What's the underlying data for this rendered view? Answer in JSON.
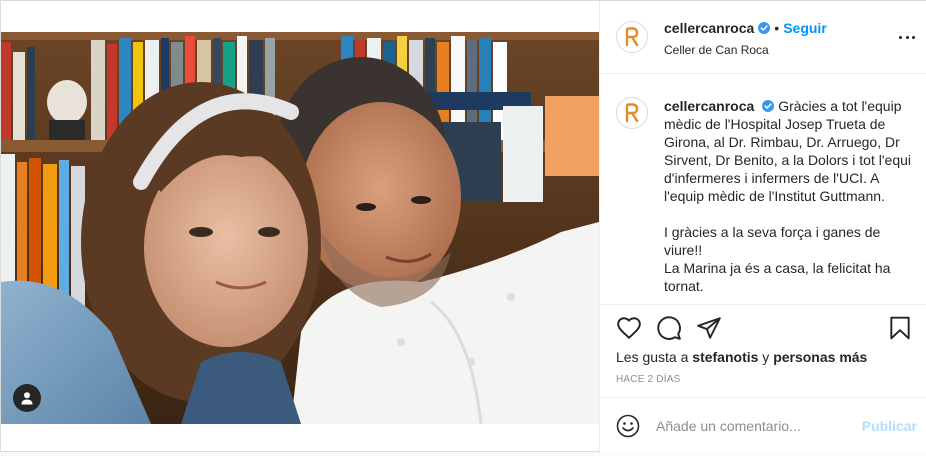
{
  "colors": {
    "accent": "#0095f6",
    "publish_disabled": "#b2dffc",
    "logo": "#e8892a",
    "text": "#262626",
    "muted": "#8e8e8e"
  },
  "photo": {
    "user_tag_icon": "person-icon"
  },
  "header": {
    "username": "cellercanroca",
    "dot": "•",
    "follow_label": "Seguir",
    "location": "Celler de Can Roca",
    "more_icon": "more-horizontal-icon"
  },
  "caption": {
    "username": "cellercanroca",
    "paragraph1": "Gràcies a tot l'equip mèdic de l'Hospital Josep Trueta de Girona, al Dr. Rimbau, Dr. Arruego, Dr Sirvent, Dr Benito, a la Dolors i tot l'equi d'infermeres i infermers de l'UCI. A l'equip mèdic de l'Institut Guttmann.",
    "paragraph2": "I gràcies a la seva força i ganes de viure!!",
    "paragraph3": "La Marina ja és a casa, la felicitat ha tornat."
  },
  "actions": {
    "like_icon": "heart-icon",
    "comment_icon": "comment-icon",
    "share_icon": "paper-plane-icon",
    "save_icon": "bookmark-icon"
  },
  "likes": {
    "prefix": "Les gusta a ",
    "user": "stefanotis",
    "middle": " y ",
    "others": "personas más"
  },
  "timestamp": "HACE 2 DÍAS",
  "comment": {
    "placeholder": "Añade un comentario...",
    "publish_label": "Publicar",
    "emoji_icon": "emoji-icon"
  }
}
